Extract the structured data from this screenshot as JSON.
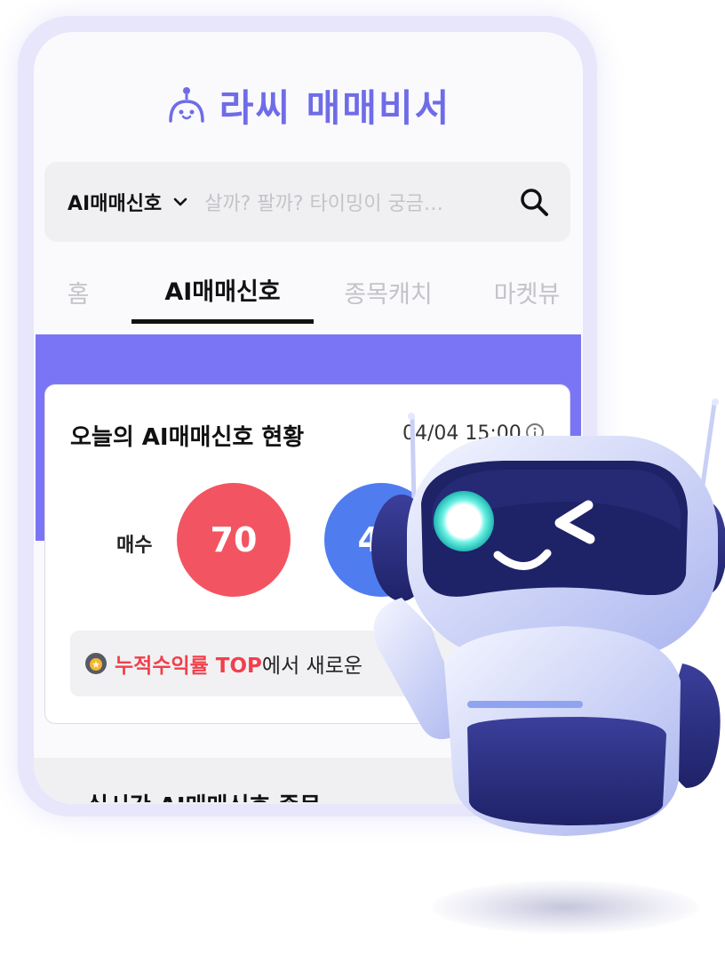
{
  "brand": {
    "name": "라씨 매매비서",
    "logo_icon": "robot-head-icon",
    "color": "#6f6ce8"
  },
  "search": {
    "category": "AI매매신호",
    "placeholder": "살까? 팔까? 타이밍이 궁금…",
    "search_icon": "search-icon"
  },
  "tabs": [
    {
      "label": "홈",
      "active": false
    },
    {
      "label": "AI매매신호",
      "active": true
    },
    {
      "label": "종목캐치",
      "active": false
    },
    {
      "label": "마켓뷰",
      "active": false
    }
  ],
  "signal_card": {
    "title": "오늘의 AI매매신호 현황",
    "time": "04/04 15:00",
    "buy_label": "매수",
    "buy_count": "70",
    "sell_count": "46",
    "notice_highlight": "누적수익률 TOP",
    "notice_rest": "에서 새로운"
  },
  "next_section": {
    "title": "실시간 AI매매신호 종목"
  },
  "colors": {
    "accent": "#7a75f5",
    "buy": "#f25561",
    "sell": "#4f7df0",
    "highlight": "#f0404b"
  }
}
